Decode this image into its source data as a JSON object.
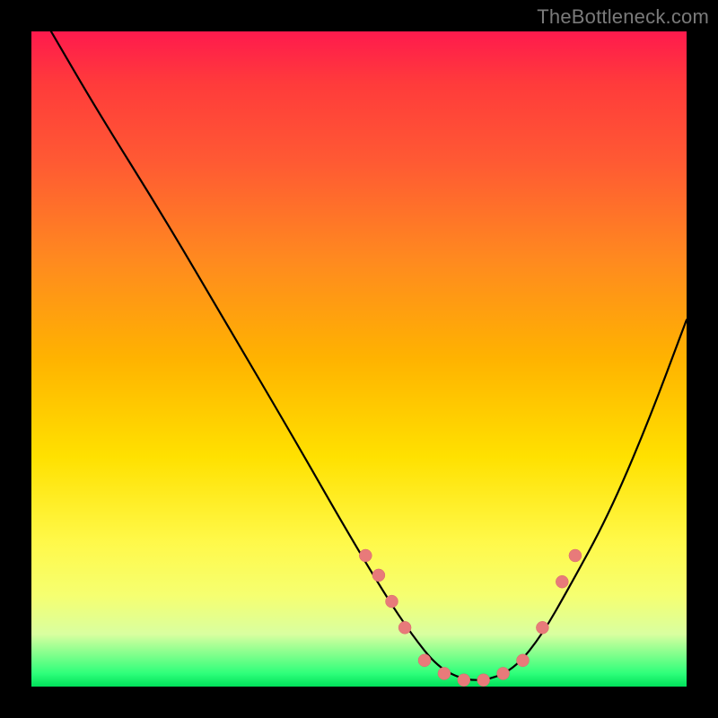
{
  "watermark": "TheBottleneck.com",
  "chart_data": {
    "type": "line",
    "title": "",
    "xlabel": "",
    "ylabel": "",
    "xlim": [
      0,
      100
    ],
    "ylim": [
      0,
      100
    ],
    "grid": false,
    "legend": false,
    "background_gradient": {
      "direction": "vertical",
      "stops": [
        {
          "pos": 0,
          "color": "#ff1a4d"
        },
        {
          "pos": 50,
          "color": "#ffb300"
        },
        {
          "pos": 78,
          "color": "#fff94a"
        },
        {
          "pos": 100,
          "color": "#00e05a"
        }
      ]
    },
    "series": [
      {
        "name": "curve",
        "color": "#000000",
        "x": [
          3,
          10,
          20,
          30,
          40,
          48,
          54,
          58,
          62,
          66,
          70,
          74,
          78,
          82,
          88,
          94,
          100
        ],
        "y": [
          100,
          88,
          72,
          55,
          38,
          24,
          14,
          8,
          3,
          1,
          1,
          3,
          8,
          15,
          26,
          40,
          56
        ]
      }
    ],
    "markers": {
      "name": "dots",
      "color": "#e87a7a",
      "x": [
        51,
        53,
        55,
        57,
        60,
        63,
        66,
        69,
        72,
        75,
        78,
        81,
        83
      ],
      "y": [
        20,
        17,
        13,
        9,
        4,
        2,
        1,
        1,
        2,
        4,
        9,
        16,
        20
      ]
    }
  }
}
